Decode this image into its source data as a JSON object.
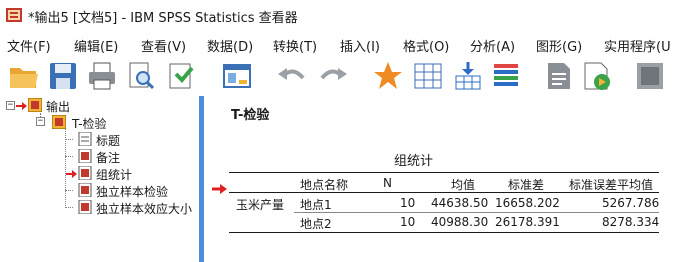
{
  "window": {
    "title": "*输出5 [文档5] - IBM SPSS Statistics 查看器"
  },
  "menu": [
    "文件(F)",
    "编辑(E)",
    "查看(V)",
    "数据(D)",
    "转换(T)",
    "插入(I)",
    "格式(O)",
    "分析(A)",
    "图形(G)",
    "实用程序(U"
  ],
  "toolbar": {
    "icons": [
      "open-icon",
      "save-icon",
      "print-icon",
      "print-preview-icon",
      "export-icon",
      "recall-dialog-icon",
      "undo-icon",
      "redo-icon",
      "goto-case-icon",
      "goto-variable-icon",
      "select-cases-icon",
      "variables-icon",
      "insert-text-icon",
      "insert-script-icon",
      "hide-icon"
    ]
  },
  "outline": {
    "root": "输出",
    "group": "T-检验",
    "items": [
      "标题",
      "备注",
      "组统计",
      "独立样本检验",
      "独立样本效应大小"
    ],
    "current_item": "组统计"
  },
  "content": {
    "heading": "T-检验",
    "table": {
      "title": "组统计",
      "columns": [
        "地点名称",
        "N",
        "均值",
        "标准差",
        "标准误差平均值"
      ],
      "row_group": "玉米产量",
      "rows": [
        [
          "地点1",
          "10",
          "44638.50",
          "16658.202",
          "5267.786"
        ],
        [
          "地点2",
          "10",
          "40988.30",
          "26178.391",
          "8278.334"
        ]
      ]
    }
  },
  "colors": {
    "accent": "#4a90d9",
    "arrow": "#e02020"
  }
}
